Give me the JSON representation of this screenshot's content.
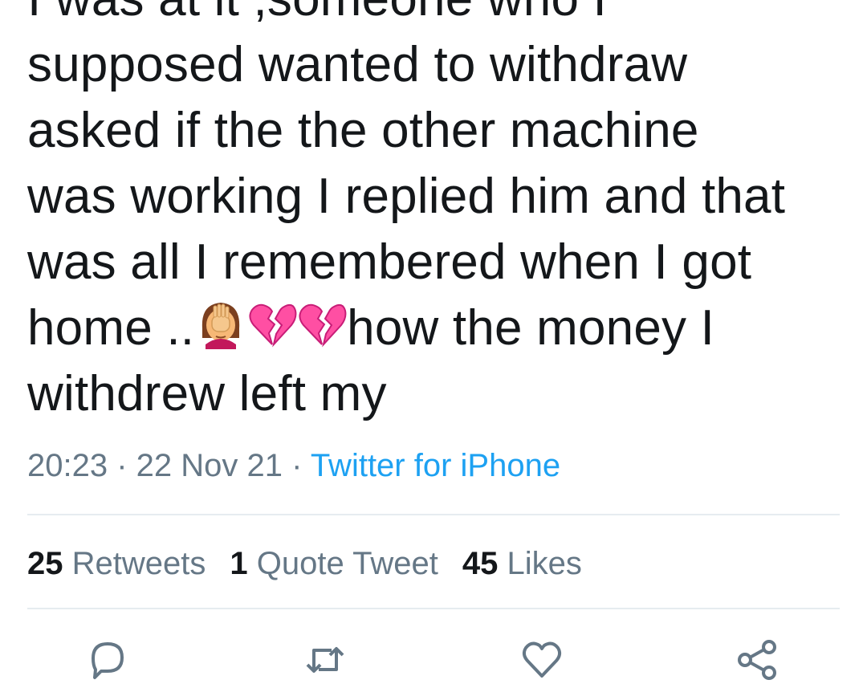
{
  "tweet": {
    "lines": [
      "I was at it ,someone who I",
      "supposed wanted to withdraw",
      "asked if the the other machine",
      "was working I replied him and that",
      "was all I remembered when I got",
      "how the money I",
      "withdrew left my"
    ],
    "line6_prefix": "home ..",
    "emojis": [
      "woman-facepalming-emoji",
      "broken-heart-emoji",
      "broken-heart-emoji"
    ]
  },
  "meta": {
    "time": "20:23",
    "separator": " · ",
    "date": "22 Nov 21",
    "source": "Twitter for iPhone"
  },
  "stats": {
    "retweets_count": "25",
    "retweets_label": "Retweets",
    "quotes_count": "1",
    "quotes_label": "Quote Tweet",
    "likes_count": "45",
    "likes_label": "Likes"
  },
  "actions": {
    "icons": [
      "reply-icon",
      "retweet-icon",
      "like-icon",
      "share-icon"
    ]
  },
  "colors": {
    "text": "#14171a",
    "secondary": "#657786",
    "link": "#1da1f2",
    "divider": "#e6ecf0",
    "heart_pink": "#ff4fa3"
  }
}
